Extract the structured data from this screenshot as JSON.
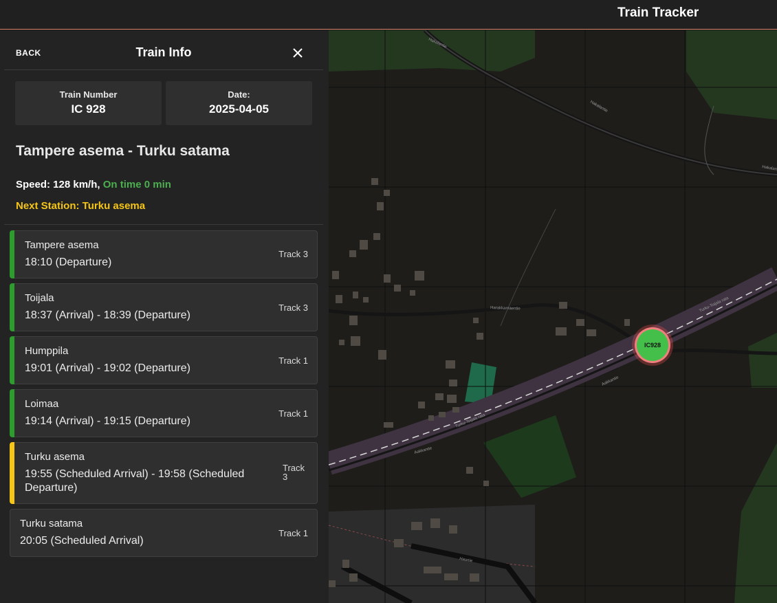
{
  "app": {
    "title": "Train Tracker"
  },
  "panel": {
    "back_label": "BACK",
    "title": "Train Info",
    "close_icon": "close-icon",
    "train_number_label": "Train Number",
    "train_number": "IC 928",
    "date_label": "Date:",
    "date": "2025-04-05",
    "route": "Tampere asema - Turku satama",
    "speed_text": "Speed: 128 km/h,",
    "status_text": "On time 0 min",
    "next_station_text": "Next Station: Turku asema"
  },
  "stops": [
    {
      "name": "Tampere asema",
      "times": "18:10 (Departure)",
      "track": "Track 3",
      "status": "passed"
    },
    {
      "name": "Toijala",
      "times": "18:37 (Arrival) - 18:39 (Departure)",
      "track": "Track 3",
      "status": "passed"
    },
    {
      "name": "Humppila",
      "times": "19:01 (Arrival) - 19:02 (Departure)",
      "track": "Track 1",
      "status": "passed"
    },
    {
      "name": "Loimaa",
      "times": "19:14 (Arrival) - 19:15 (Departure)",
      "track": "Track 1",
      "status": "passed"
    },
    {
      "name": "Turku asema",
      "times": "19:55 (Scheduled Arrival) - 19:58 (Scheduled Departure)",
      "track": "Track 3",
      "status": "next"
    },
    {
      "name": "Turku satama",
      "times": "20:05 (Scheduled Arrival)",
      "track": "Track 1",
      "status": "upcoming"
    }
  ],
  "map": {
    "marker_label": "IC928",
    "road_labels": [
      "Hakalantie",
      "Hakalantie",
      "Hakalantie",
      "Harakkamäentie",
      "Turku-Toijala rata",
      "Turku-Toijala rata",
      "Aakkantie",
      "Aakkantie",
      "Haunie"
    ]
  },
  "colors": {
    "passed": "#2e9b2e",
    "next": "#f5c518",
    "on_time": "#4caf50",
    "marker": "#44c04a",
    "accent_line": "#d9826a"
  }
}
